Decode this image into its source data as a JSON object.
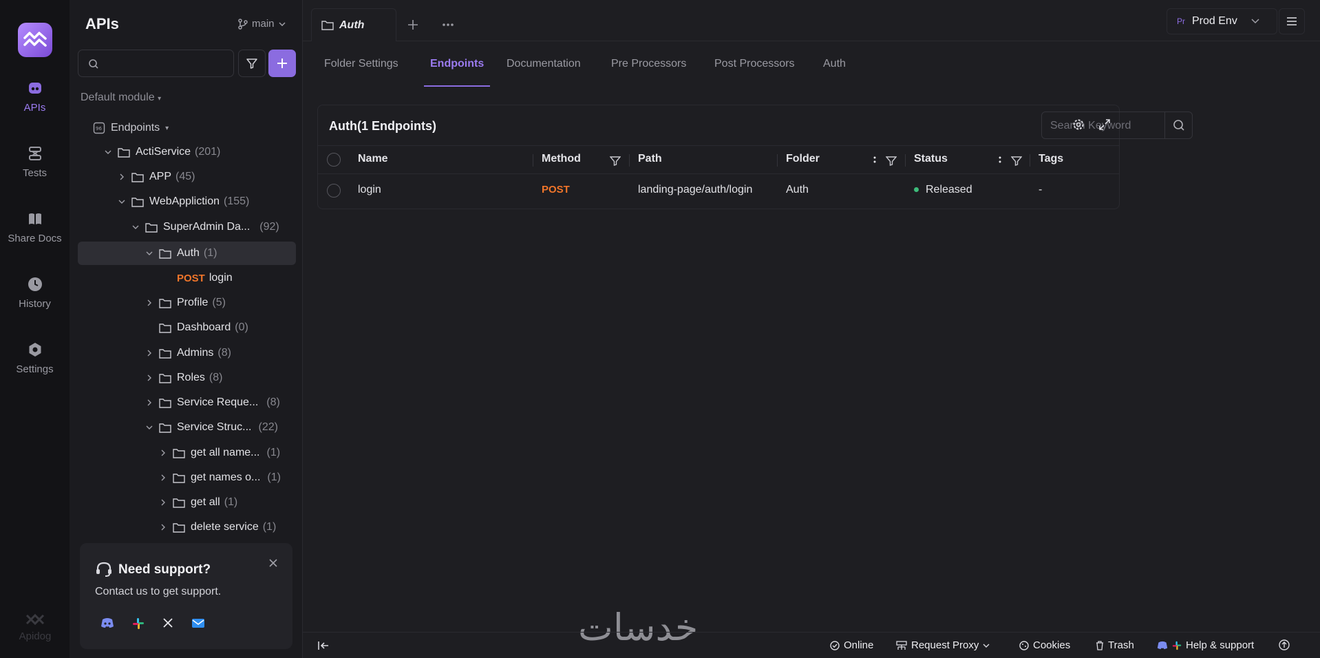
{
  "rail": {
    "items": [
      {
        "label": "APIs",
        "icon": "api-icon",
        "active": true
      },
      {
        "label": "Tests",
        "icon": "tests-icon"
      },
      {
        "label": "Share Docs",
        "icon": "book-icon"
      },
      {
        "label": "History",
        "icon": "clock-icon"
      },
      {
        "label": "Settings",
        "icon": "gear-icon"
      }
    ],
    "brand": "Apidog"
  },
  "sidebar": {
    "title": "APIs",
    "branch": "main",
    "search_placeholder": "",
    "module": "Default module",
    "tree": [
      {
        "label": "Endpoints",
        "count": ""
      },
      {
        "label": "ActiService",
        "count": "(201)"
      },
      {
        "label": "APP",
        "count": "(45)"
      },
      {
        "label": "WebAppliction",
        "count": "(155)"
      },
      {
        "label": "SuperAdmin Da...",
        "count": "(92)"
      },
      {
        "label": "Auth",
        "count": "(1)"
      },
      {
        "method": "POST",
        "label": "login"
      },
      {
        "label": "Profile",
        "count": "(5)"
      },
      {
        "label": "Dashboard",
        "count": "(0)"
      },
      {
        "label": "Admins",
        "count": "(8)"
      },
      {
        "label": "Roles",
        "count": "(8)"
      },
      {
        "label": "Service Reque...",
        "count": "(8)"
      },
      {
        "label": "Service Struc...",
        "count": "(22)"
      },
      {
        "label": "get all name...",
        "count": "(1)"
      },
      {
        "label": "get names o...",
        "count": "(1)"
      },
      {
        "label": "get all",
        "count": "(1)"
      },
      {
        "label": "delete service",
        "count": "(1)"
      }
    ],
    "support": {
      "title": "Need support?",
      "subtitle": "Contact us to get support."
    }
  },
  "topbar": {
    "tab_label": "Auth",
    "env_badge": "Pr",
    "env_label": "Prod Env"
  },
  "subtabs": [
    "Folder Settings",
    "Endpoints",
    "Documentation",
    "Pre Processors",
    "Post Processors",
    "Auth"
  ],
  "panel": {
    "title": "Auth(1 Endpoints)",
    "search_placeholder": "Search Keyword",
    "columns": [
      "Name",
      "Method",
      "Path",
      "Folder",
      "Status",
      "Tags"
    ],
    "rows": [
      {
        "name": "login",
        "method": "POST",
        "path": "landing-page/auth/login",
        "folder": "Auth",
        "status": "Released",
        "tags": "-"
      }
    ]
  },
  "bottombar": {
    "online": "Online",
    "proxy": "Request Proxy",
    "cookies": "Cookies",
    "trash": "Trash",
    "help": "Help & support"
  },
  "watermark": "خدسات",
  "colors": {
    "accent": "#8b6ce0",
    "post": "#f0752a",
    "released": "#3dbb7a"
  }
}
